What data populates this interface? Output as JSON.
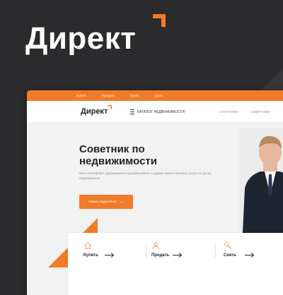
{
  "brand": {
    "name": "Директ"
  },
  "site": {
    "topbar": {
      "links": [
        "Купить",
        "Продать",
        "Снять",
        "Сдать"
      ]
    },
    "header": {
      "logo": "Директ",
      "catalog_label": "КАТАЛОГ НЕДВИЖИМОСТИ",
      "links": [
        "АГЕНТСТВО",
        "СОВЕТНИКИ"
      ]
    },
    "hero": {
      "title": "Советник по недвижимости",
      "subtitle": "Мы в интерфейсе одновременно прорабатываем, создавая новые полезные услуги по рынку недвижимости",
      "cta_label": "Узнать подробнее",
      "cta_arrow": "→"
    },
    "actions": [
      {
        "label": "Купить",
        "icon": "house-icon"
      },
      {
        "label": "Продать",
        "icon": "seller-icon"
      },
      {
        "label": "Снять",
        "icon": "key-icon"
      }
    ]
  },
  "colors": {
    "accent": "#f07c29",
    "background": "#2b2b2d"
  }
}
